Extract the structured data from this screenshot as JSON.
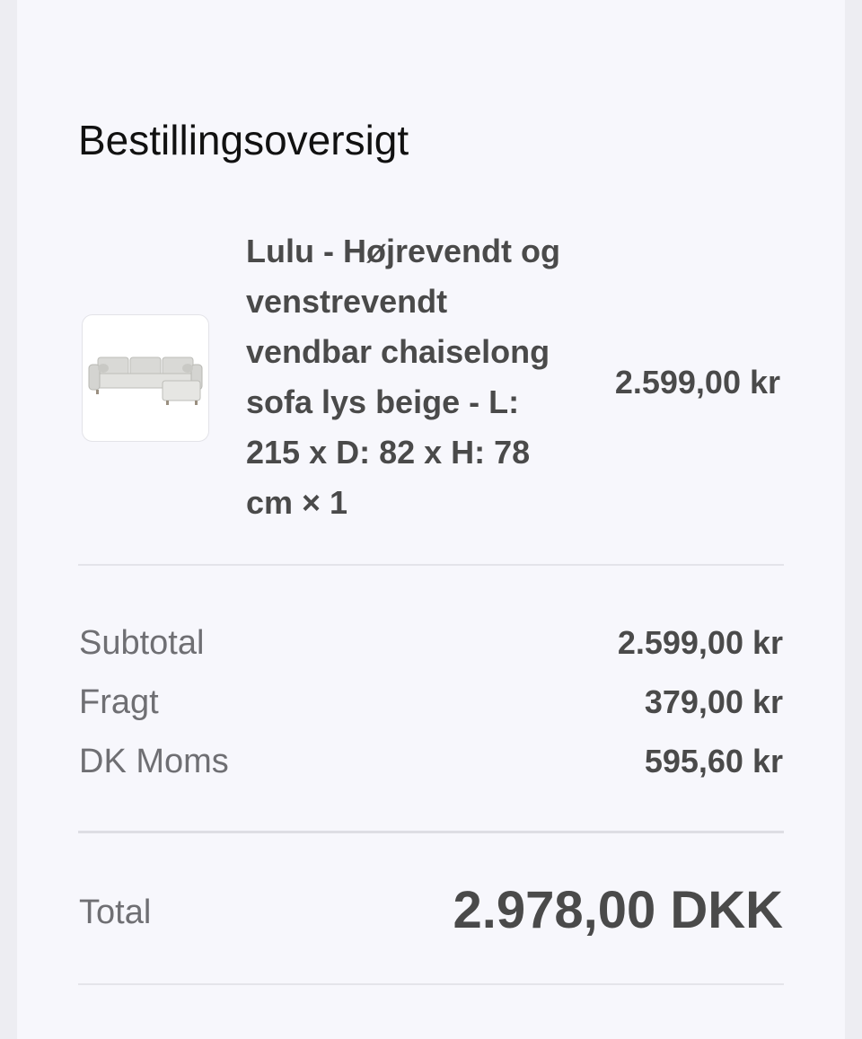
{
  "summary": {
    "title": "Bestillingsoversigt"
  },
  "item": {
    "name": "Lulu - Højrevendt og venstrevendt vendbar chaiselong sofa lys beige - L: 215 x D: 82 x H: 78 cm × 1",
    "price": "2.599,00 kr",
    "image_icon": "sofa-image"
  },
  "totals": {
    "subtotal_label": "Subtotal",
    "subtotal_value": "2.599,00 kr",
    "shipping_label": "Fragt",
    "shipping_value": "379,00 kr",
    "vat_label": "DK Moms",
    "vat_value": "595,60 kr",
    "total_label": "Total",
    "total_value": "2.978,00 DKK"
  },
  "colors": {
    "background": "#ededf2",
    "panel": "#f7f7fc",
    "text_dark": "#111111",
    "text_bold": "#4a4a4a",
    "text_muted": "#6f6f73",
    "divider": "#e4e4ea"
  }
}
